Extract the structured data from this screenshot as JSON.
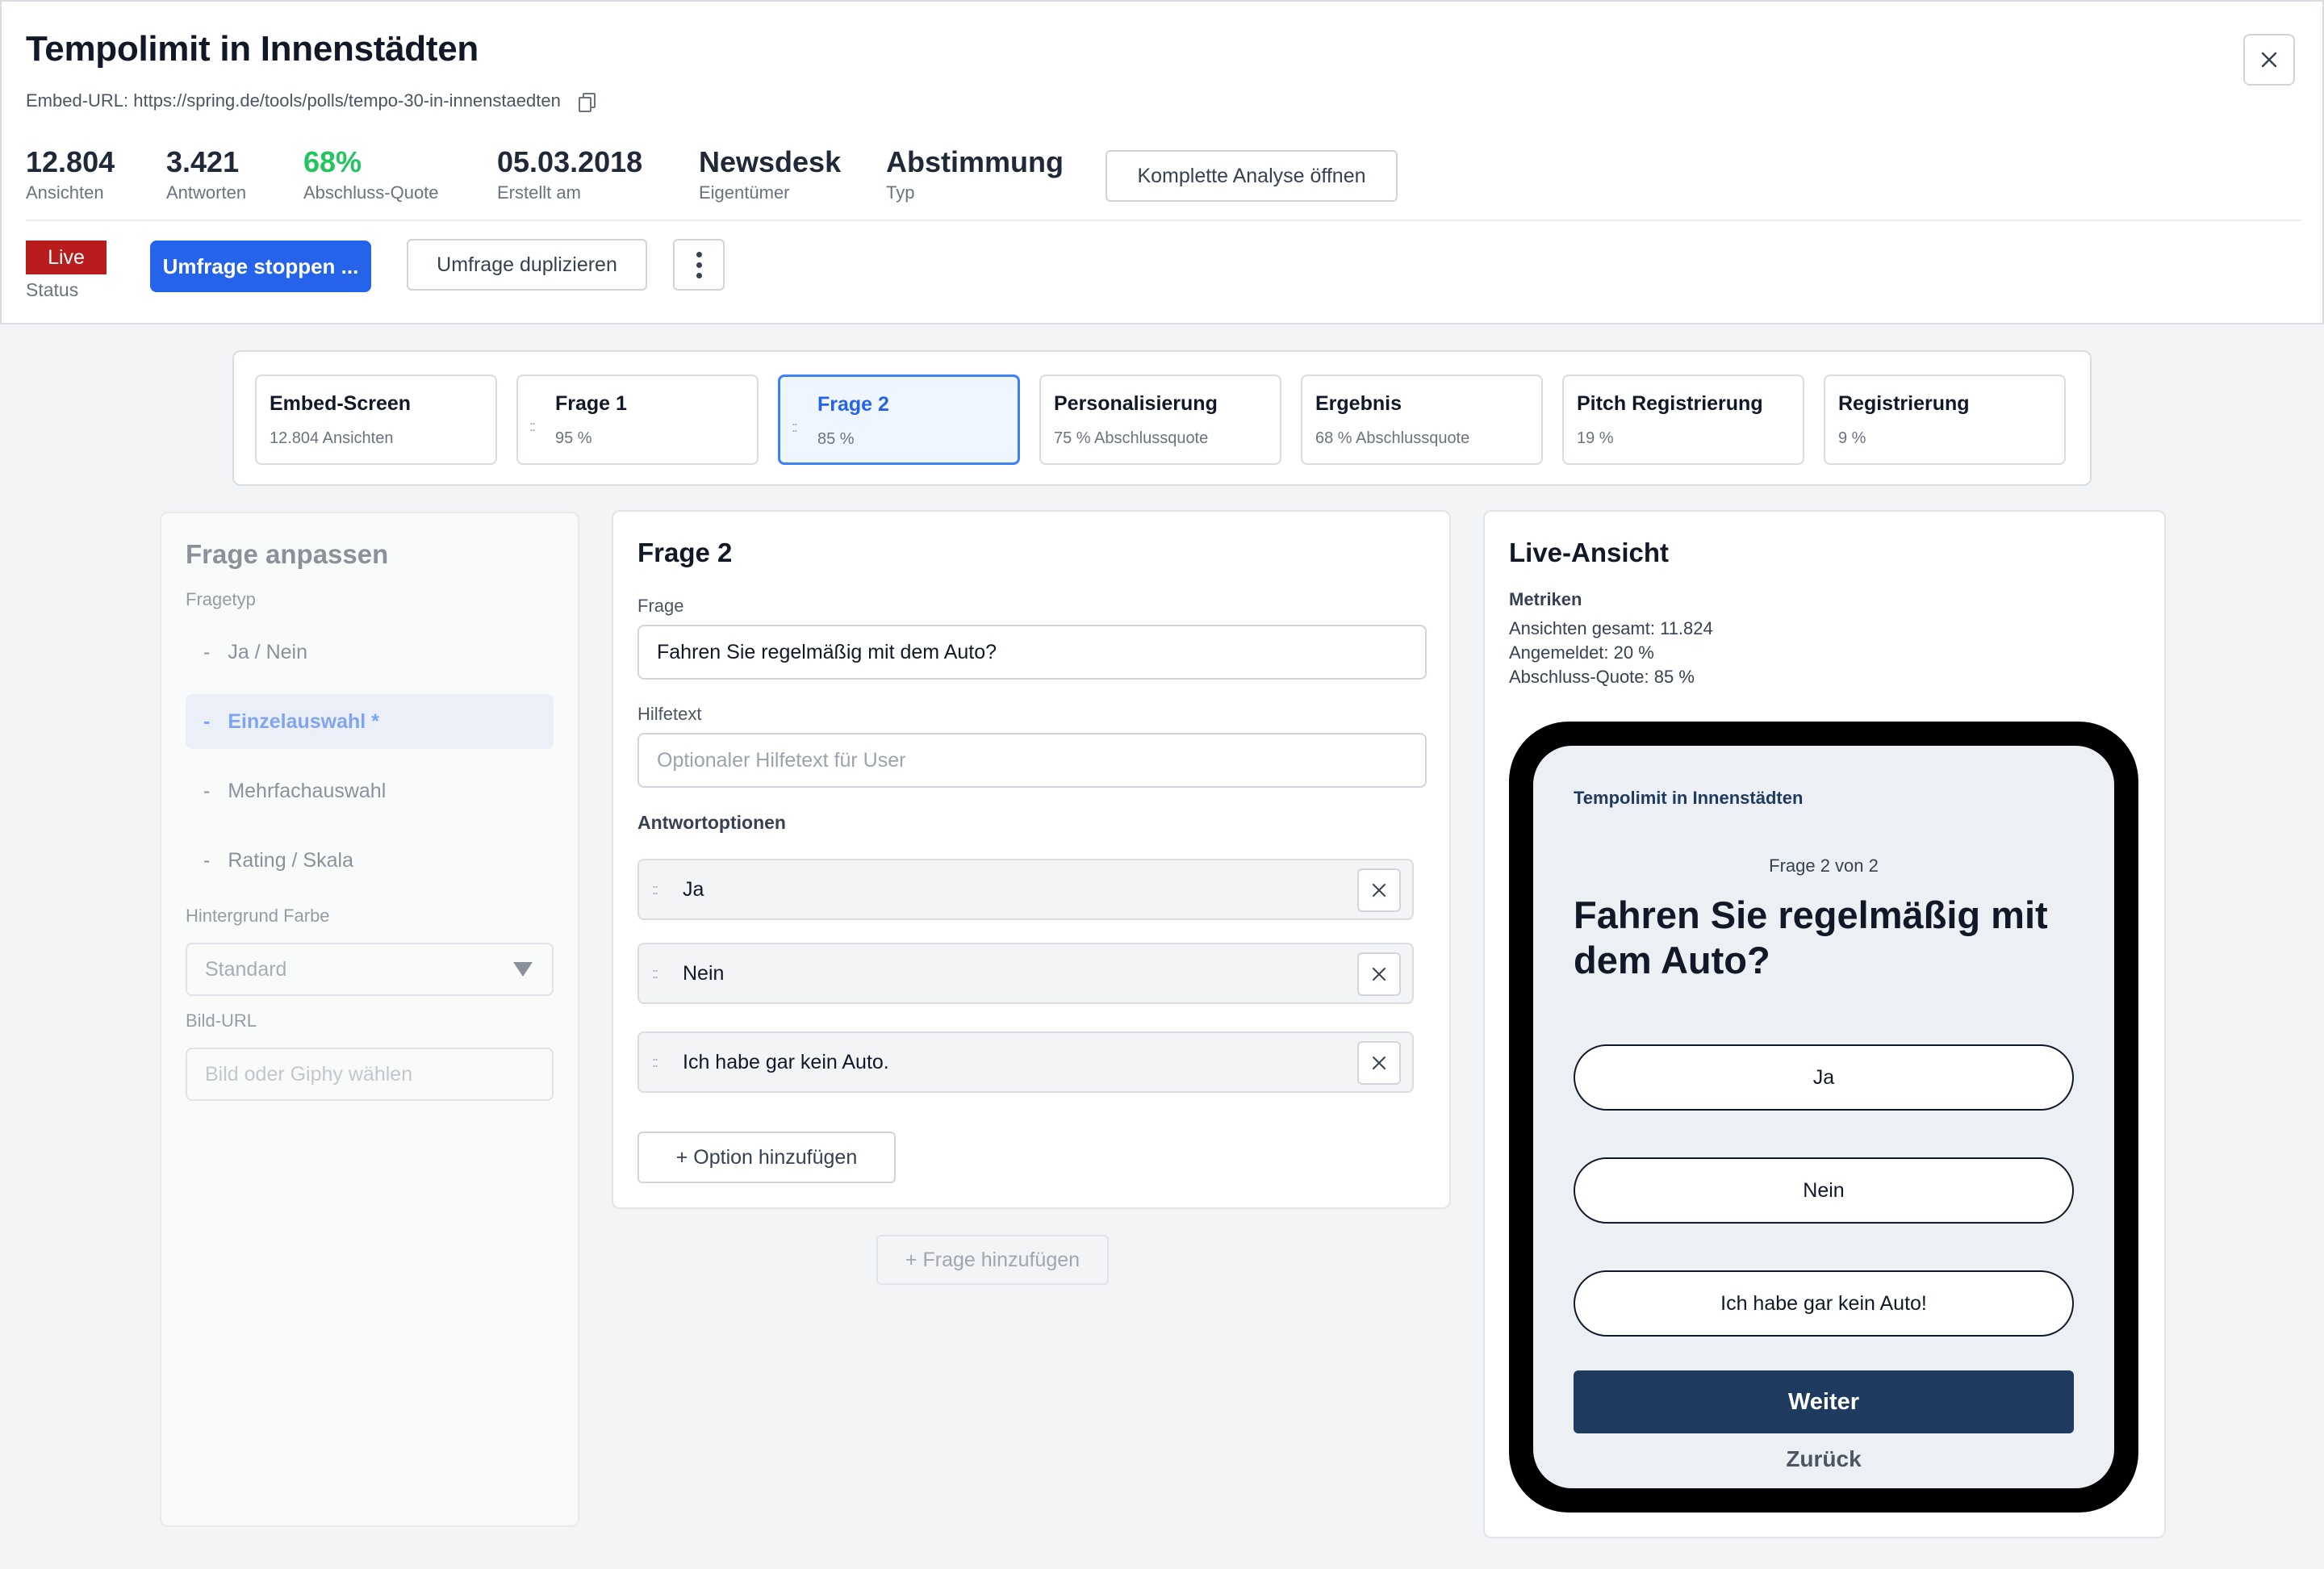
{
  "header": {
    "title": "Tempolimit in Innenstädten",
    "embed_url_text": "Embed-URL: https://spring.de/tools/polls/tempo-30-in-innenstaedten",
    "stats": [
      {
        "value": "12.804",
        "label": "Ansichten"
      },
      {
        "value": "3.421",
        "label": "Antworten"
      },
      {
        "value": "68%",
        "label": "Abschluss-Quote"
      },
      {
        "value": "05.03.2018",
        "label": "Erstellt am"
      },
      {
        "value": "Newsdesk",
        "label": "Eigentümer"
      },
      {
        "value": "Abstimmung",
        "label": "Typ"
      }
    ],
    "analysis_button": "Komplette Analyse öffnen",
    "status_badge": "Live",
    "status_label": "Status",
    "stop_button": "Umfrage stoppen ...",
    "duplicate_button": "Umfrage duplizieren"
  },
  "steps": [
    {
      "title": "Embed-Screen",
      "sub": "12.804 Ansichten"
    },
    {
      "title": "Frage 1",
      "sub": "95 %"
    },
    {
      "title": "Frage 2",
      "sub": "85 %"
    },
    {
      "title": "Personalisierung",
      "sub": "75 % Abschlussquote"
    },
    {
      "title": "Ergebnis",
      "sub": "68 % Abschlussquote"
    },
    {
      "title": "Pitch Registrierung",
      "sub": "19 %"
    },
    {
      "title": "Registrierung",
      "sub": "9 %"
    }
  ],
  "customize": {
    "title": "Frage anpassen",
    "type_label": "Fragetyp",
    "types": [
      "Ja / Nein",
      "Einzelauswahl *",
      "Mehrfachauswahl",
      "Rating / Skala"
    ],
    "bg_label": "Hintergrund Farbe",
    "bg_value": "Standard",
    "img_label": "Bild-URL",
    "img_placeholder": "Bild oder Giphy wählen"
  },
  "editor": {
    "title": "Frage 2",
    "question_label": "Frage",
    "question_value": "Fahren Sie regelmäßig mit dem Auto?",
    "help_label": "Hilfetext",
    "help_placeholder": "Optionaler Hilfetext für User",
    "options_label": "Antwortoptionen",
    "options": [
      "Ja",
      "Nein",
      "Ich habe gar kein Auto."
    ],
    "add_option": "+ Option hinzufügen",
    "add_question": "+ Frage hinzufügen"
  },
  "preview": {
    "title": "Live-Ansicht",
    "metrics_title": "Metriken",
    "metrics": [
      "Ansichten gesamt: 11.824",
      "Angemeldet: 20 %",
      "Abschluss-Quote: 85 %"
    ],
    "screen_title": "Tempolimit in Innenstädten",
    "progress": "Frage 2 von 2",
    "question": "Fahren Sie regelmäßig mit dem Auto?",
    "options": [
      "Ja",
      "Nein",
      "Ich habe gar kein Auto!"
    ],
    "next": "Weiter",
    "back": "Zurück"
  },
  "colors": {
    "primary": "#2563eb",
    "live": "#b91c1c",
    "success": "#22c55e",
    "navy": "#1e3a5f"
  }
}
